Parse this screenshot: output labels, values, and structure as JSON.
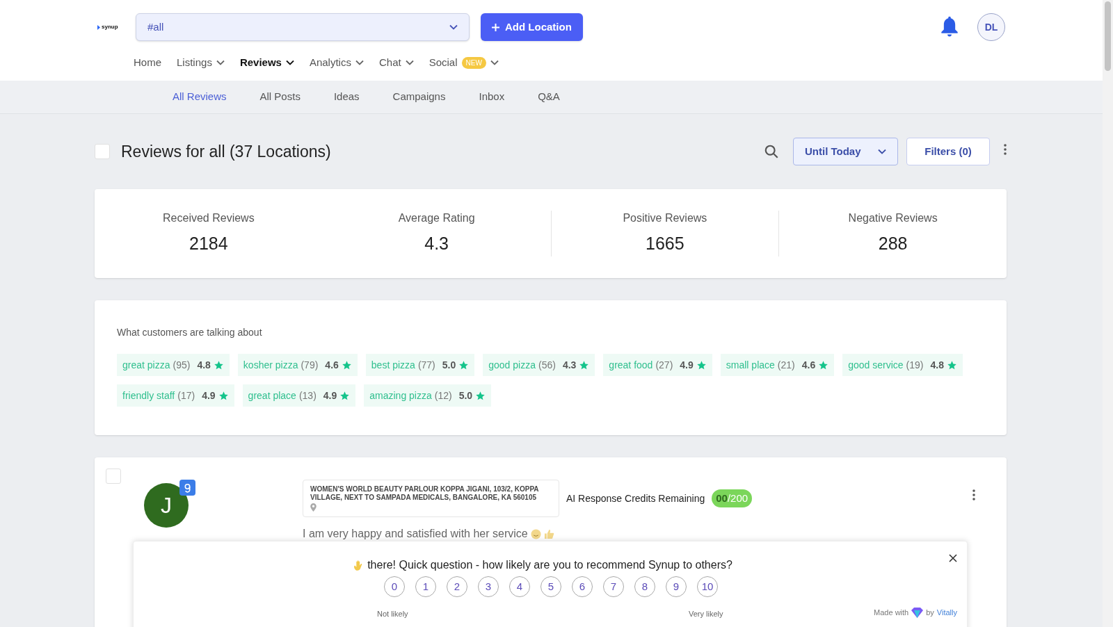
{
  "header": {
    "logo": "synup",
    "location_select": {
      "value": "#all"
    },
    "add_button": "Add Location",
    "avatar": "DL"
  },
  "nav": [
    {
      "label": "Home",
      "dropdown": false,
      "selected": false
    },
    {
      "label": "Listings",
      "dropdown": true,
      "selected": false
    },
    {
      "label": "Reviews",
      "dropdown": true,
      "selected": true
    },
    {
      "label": "Analytics",
      "dropdown": true,
      "selected": false
    },
    {
      "label": "Chat",
      "dropdown": true,
      "selected": false
    },
    {
      "label": "Social",
      "dropdown": true,
      "selected": false,
      "badge": "NEW"
    }
  ],
  "subnav": [
    {
      "label": "All Reviews",
      "selected": true
    },
    {
      "label": "All Posts",
      "selected": false
    },
    {
      "label": "Ideas",
      "selected": false
    },
    {
      "label": "Campaigns",
      "selected": false
    },
    {
      "label": "Inbox",
      "selected": false
    },
    {
      "label": "Q&A",
      "selected": false
    }
  ],
  "toolbar": {
    "select_all_checked": false,
    "title": "Reviews for all (37 Locations)",
    "date_filter": "Until Today",
    "filters_button": "Filters (0)"
  },
  "stats": [
    {
      "label": "Received Reviews",
      "value": "2184"
    },
    {
      "label": "Average Rating",
      "value": "4.3"
    },
    {
      "label": "Positive Reviews",
      "value": "1665"
    },
    {
      "label": "Negative Reviews",
      "value": "288"
    }
  ],
  "topics": {
    "title": "What customers are talking about",
    "tags": [
      {
        "phrase": "great pizza",
        "count": "(95)",
        "rating": "4.8"
      },
      {
        "phrase": "kosher pizza",
        "count": "(79)",
        "rating": "4.6"
      },
      {
        "phrase": "best pizza",
        "count": "(77)",
        "rating": "5.0"
      },
      {
        "phrase": "good pizza",
        "count": "(56)",
        "rating": "4.3"
      },
      {
        "phrase": "great food",
        "count": "(27)",
        "rating": "4.9"
      },
      {
        "phrase": "small place",
        "count": "(21)",
        "rating": "4.6"
      },
      {
        "phrase": "good service",
        "count": "(19)",
        "rating": "4.8"
      },
      {
        "phrase": "friendly staff",
        "count": "(17)",
        "rating": "4.9"
      },
      {
        "phrase": "great place",
        "count": "(13)",
        "rating": "4.9"
      },
      {
        "phrase": "amazing pizza",
        "count": "(12)",
        "rating": "5.0"
      }
    ]
  },
  "review": {
    "checked": false,
    "avatar_letter": "J",
    "location": "WOMEN'S WORLD BEAUTY PARLOUR KOPPA JIGANI, 103/2, KOPPA VILLAGE, NEXT TO SAMPADA MEDICALS, BANGALORE, KA 560105",
    "credits_label": "AI Response Credits Remaining",
    "credits_used": "00",
    "credits_total": "/200",
    "text": "I am very happy and satisfied with her service"
  },
  "survey": {
    "question": "there! Quick question - how likely are you to recommend Synup to others?",
    "scores": [
      "0",
      "1",
      "2",
      "3",
      "4",
      "5",
      "6",
      "7",
      "8",
      "9",
      "10"
    ],
    "low_label": "Not likely",
    "high_label": "Very likely",
    "made_with": "Made with",
    "by": "by",
    "brand": "Vitally"
  }
}
